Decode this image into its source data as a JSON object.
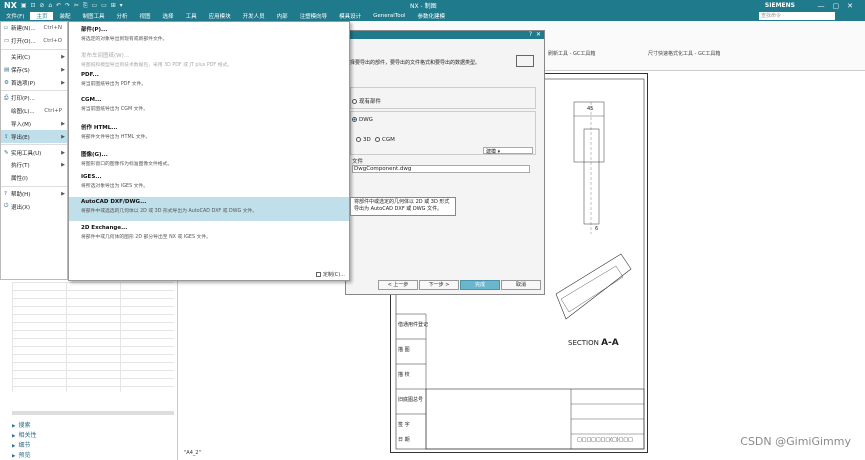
{
  "app": {
    "logo": "NX",
    "window_title": "NX - 制图",
    "brand": "SIEMENS",
    "qat": "▣ ⊡ ⊘ ⌂ ↶ ↷ ✂ ⎘ ▭ ▭ ⊞ ▾"
  },
  "menubar": {
    "items": [
      "文件(F)",
      "主页",
      "装配",
      "制图工具",
      "分析",
      "视图",
      "选择",
      "工具",
      "应用模块",
      "开发人员",
      "内部",
      "注塑模向导",
      "模具设计",
      "GeneralTool",
      "参数化建模"
    ],
    "active_index": 1,
    "search_placeholder": "查找命令",
    "extra_items": [
      "级进模向导"
    ]
  },
  "ribbon": {
    "groups": [
      "刷新工具 - GC工具箱",
      "尺寸快速格式化工具 - GC工具箱"
    ]
  },
  "file_menu": {
    "items": [
      {
        "label": "新建(N)...",
        "shortcut": "Ctrl+N",
        "icon": "new-icon"
      },
      {
        "label": "打开(O)...",
        "shortcut": "Ctrl+O",
        "icon": "open-icon"
      },
      {
        "label": "关闭(C)",
        "shortcut": "",
        "icon": "",
        "submenu": true
      },
      {
        "label": "保存(S)",
        "shortcut": "",
        "icon": "save-icon",
        "submenu": true
      },
      {
        "label": "首选项(P)",
        "shortcut": "",
        "icon": "preferences-icon",
        "submenu": true
      },
      {
        "label": "打印(P)...",
        "shortcut": "",
        "icon": "print-icon"
      },
      {
        "label": "绘图(L)...",
        "shortcut": "Ctrl+P",
        "icon": ""
      },
      {
        "label": "导入(M)",
        "shortcut": "",
        "icon": "",
        "submenu": true
      },
      {
        "label": "导出(E)",
        "shortcut": "",
        "icon": "export-icon",
        "submenu": true,
        "selected": true
      },
      {
        "label": "实用工具(U)",
        "shortcut": "",
        "icon": "utilities-icon",
        "submenu": true
      },
      {
        "label": "执行(T)",
        "shortcut": "",
        "icon": "",
        "submenu": true
      },
      {
        "label": "属性(I)",
        "shortcut": "",
        "icon": ""
      },
      {
        "label": "帮助(H)",
        "shortcut": "",
        "icon": "help-icon",
        "submenu": true
      },
      {
        "label": "退出(X)",
        "shortcut": "",
        "icon": "exit-icon"
      }
    ]
  },
  "export_menu": {
    "items": [
      {
        "title": "部件(P)...",
        "desc": "将选定的对象导出到现有或新部件文件。",
        "disabled": false
      },
      {
        "title": "发布车间图纸(W)...",
        "desc": "将图纸和模型导出到技术数据包，采用 3D PDF 或 JT plus PDF 格式。",
        "disabled": true
      },
      {
        "title": "PDF...",
        "desc": "将当前图纸导出为 PDF 文件。",
        "disabled": false
      },
      {
        "title": "CGM...",
        "desc": "将当前图纸导出为 CGM 文件。",
        "disabled": false
      },
      {
        "title": "创作 HTML...",
        "desc": "将部件文件导出为 HTML 文件。",
        "disabled": false
      },
      {
        "title": "图像(G)...",
        "desc": "将图形窗口的图像作为标准图像文件格式。",
        "disabled": false
      },
      {
        "title": "IGES...",
        "desc": "将所选对象导出为 IGES 文件。",
        "disabled": false
      },
      {
        "title": "AutoCAD DXF/DWG...",
        "desc": "将部件中或选选的几何体以 2D 或 3D 形式导出为 AutoCAD DXF 或 DWG 文件。",
        "disabled": false,
        "highlighted": true
      },
      {
        "title": "2D Exchange...",
        "desc": "将部件中或几何体的图形 2D 部分导出至 NX 或 IGES 文件。",
        "disabled": false
      }
    ],
    "footer": "定制(C)..."
  },
  "tooltip": {
    "text": "将部件中或选定的几何体以 2D 或 3D 形式导出为 AutoCAD DXF 或 DWG 文件。"
  },
  "wizard": {
    "intro": "择要导出的部件，要导出的文件格式和要导出的数据类型。",
    "options": {
      "existing_part": "现有部件",
      "dwg": "DWG",
      "three_d": "3D",
      "cgm": "CGM"
    },
    "dropdown": "建模",
    "file_label": "文件",
    "file_value": "DwgComponent.dwg",
    "buttons": {
      "back": "< 上一步",
      "next": "下一步 >",
      "finish": "完成",
      "cancel": "取消"
    }
  },
  "nav_pane": {
    "sections": [
      "搜索",
      "相关性",
      "细节",
      "预览"
    ]
  },
  "drawing": {
    "sheet_tab": "\"A4_2\"",
    "section_label": "SECTION",
    "section_letter": "A-A",
    "dim_top": "45",
    "dim_side": "6",
    "title_block_labels": [
      "借通用件登记",
      "描 图",
      "描 校",
      "旧底图总号",
      "签 字",
      "日 期"
    ],
    "title_block_bottom": "□□□□□□□(□)□□□"
  },
  "watermark": "CSDN @GimiGimmy",
  "colors": {
    "accent": "#1f7a8c",
    "highlight": "#bfe0ea",
    "primary_button": "#6bb6cd"
  }
}
